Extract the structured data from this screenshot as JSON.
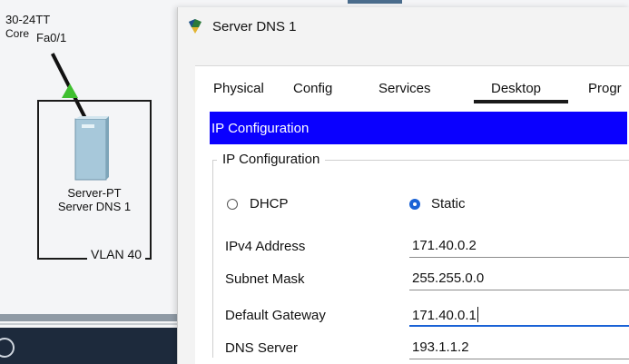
{
  "canvas": {
    "device_label": "30-24TT",
    "device_sublabel": "Core",
    "port_label": "Fa0/1",
    "server_type": "Server-PT",
    "server_name": "Server DNS 1",
    "vlan_label": "VLAN 40"
  },
  "window": {
    "title": "Server DNS 1",
    "tabs": [
      {
        "label": "Physical",
        "active": false
      },
      {
        "label": "Config",
        "active": false
      },
      {
        "label": "Services",
        "active": false
      },
      {
        "label": "Desktop",
        "active": true
      },
      {
        "label": "Progr",
        "active": false
      }
    ],
    "panel_title": "IP Configuration",
    "group_title": "IP Configuration",
    "mode": {
      "dhcp_label": "DHCP",
      "static_label": "Static",
      "selected": "Static"
    },
    "fields": {
      "ipv4_label": "IPv4 Address",
      "ipv4_value": "171.40.0.2",
      "subnet_label": "Subnet Mask",
      "subnet_value": "255.255.0.0",
      "gateway_label": "Default Gateway",
      "gateway_value": "171.40.0.1",
      "dns_label": "DNS Server",
      "dns_value": "193.1.1.2"
    }
  },
  "colors": {
    "accent_blue": "#0a00ff",
    "radio_selected": "#1a62d6",
    "link_green": "#3fbf2f"
  }
}
